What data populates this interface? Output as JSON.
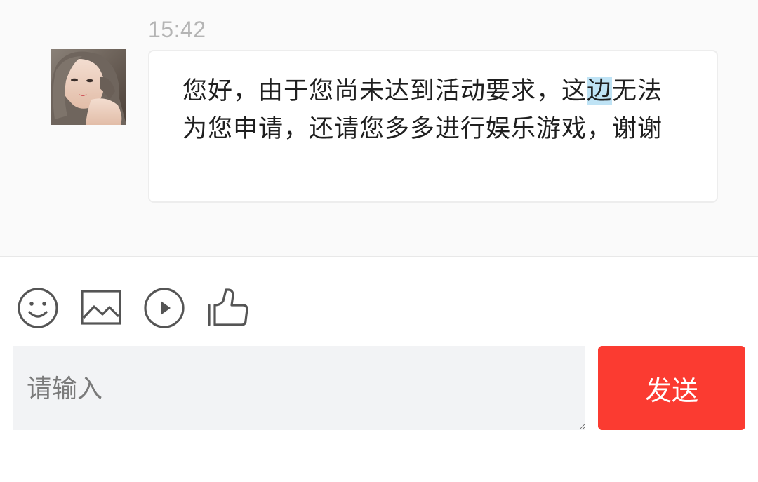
{
  "chat": {
    "timestamp": "15:42",
    "message": {
      "text_before_highlight": "您好，由于您尚未达到活动要求，这",
      "highlighted_text": "边",
      "text_after_highlight": "无法为您申请，还请您多多进行娱乐游戏，谢谢"
    }
  },
  "toolbar": {
    "icons": [
      "emoji-icon",
      "image-icon",
      "video-play-icon",
      "thumbs-up-icon"
    ]
  },
  "composer": {
    "placeholder": "请输入",
    "value": "",
    "send_label": "发送"
  },
  "colors": {
    "send_button": "#fb3b31",
    "chat_background": "#fafafa",
    "input_background": "#f2f3f5",
    "highlight": "#bfe3f5"
  }
}
